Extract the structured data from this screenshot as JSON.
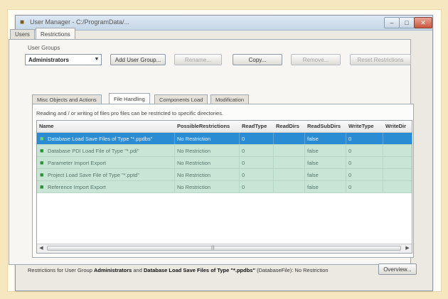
{
  "window": {
    "title": "User Manager - C:/ProgramData/..."
  },
  "window_controls": {
    "minimize": "–",
    "maximize": "□",
    "close": "✕"
  },
  "top_tabs": [
    {
      "label": "Users",
      "active": false
    },
    {
      "label": "Restrictions",
      "active": true
    }
  ],
  "user_groups": {
    "label": "User Groups",
    "selected": "Administrators",
    "buttons": {
      "add": "Add User Group...",
      "rename": "Rename...",
      "copy": "Copy...",
      "remove": "Remove...",
      "reset": "Reset Restrictions"
    }
  },
  "inner_tabs": [
    {
      "label": "Misc Objects and Actions",
      "active": false
    },
    {
      "label": "File Handling",
      "active": true
    },
    {
      "label": "Components Load",
      "active": false
    },
    {
      "label": "Modification",
      "active": false
    }
  ],
  "hint": "Reading and / or writing of files pro files can be restricted to specific directories.",
  "table": {
    "columns": [
      "Name",
      "PossibleRestrictions",
      "ReadType",
      "ReadDirs",
      "ReadSubDirs",
      "WriteType",
      "WriteDir"
    ],
    "rows": [
      {
        "name": "Database Load Save Files of Type \"*.ppdbs\"",
        "restriction": "No Restriction",
        "read_type": "0",
        "read_dirs": "",
        "read_subdirs": "false",
        "write_type": "0",
        "selected": true
      },
      {
        "name": "Database PDI Load File of Type \"*.pdi\"",
        "restriction": "No Restriction",
        "read_type": "0",
        "read_dirs": "",
        "read_subdirs": "false",
        "write_type": "0",
        "selected": false
      },
      {
        "name": "Parameter Import Export",
        "restriction": "No Restriction",
        "read_type": "0",
        "read_dirs": "",
        "read_subdirs": "false",
        "write_type": "0",
        "selected": false
      },
      {
        "name": "Project Load Save File of Type \"*.pptd\"",
        "restriction": "No Restriction",
        "read_type": "0",
        "read_dirs": "",
        "read_subdirs": "false",
        "write_type": "0",
        "selected": false
      },
      {
        "name": "Reference Import Export",
        "restriction": "No Restriction",
        "read_type": "0",
        "read_dirs": "",
        "read_subdirs": "false",
        "write_type": "0",
        "selected": false
      }
    ]
  },
  "status": {
    "prefix": "Restrictions for User Group ",
    "group": "Administrators",
    "middle": " and ",
    "item": "Database Load Save Files of Type \"*.ppdbs\"",
    "suffix": " (DatabaseFile): No Restriction",
    "overview_button": "Overview..."
  }
}
